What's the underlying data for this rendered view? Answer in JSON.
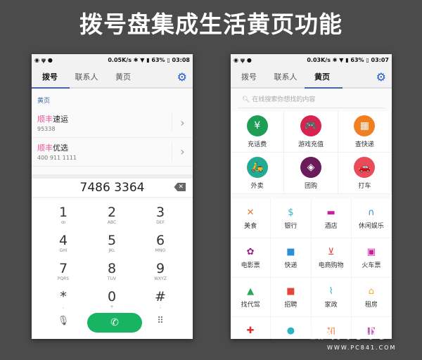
{
  "title": "拨号盘集成生活黄页功能",
  "left": {
    "status": {
      "speed": "0.05K/s",
      "battery": "63%",
      "time": "03:08"
    },
    "tabs": [
      "拨号",
      "联系人",
      "黄页"
    ],
    "section": "黄页",
    "items": [
      {
        "brand": "顺丰",
        "name": "速运",
        "phone": "95338"
      },
      {
        "brand": "顺丰",
        "name": "优选",
        "phone": "400 911 1111"
      }
    ],
    "number": "7486 3364",
    "keys": [
      {
        "d": "1",
        "l": "ꝏ"
      },
      {
        "d": "2",
        "l": "ABC"
      },
      {
        "d": "3",
        "l": "DEF"
      },
      {
        "d": "4",
        "l": "GHI"
      },
      {
        "d": "5",
        "l": "JKL"
      },
      {
        "d": "6",
        "l": "MNO"
      },
      {
        "d": "7",
        "l": "PQRS"
      },
      {
        "d": "8",
        "l": "TUV"
      },
      {
        "d": "9",
        "l": "WXYZ"
      },
      {
        "d": "*",
        "l": ","
      },
      {
        "d": "0",
        "l": "+"
      },
      {
        "d": "#",
        "l": ";"
      }
    ]
  },
  "right": {
    "status": {
      "speed": "0.03K/s",
      "battery": "63%",
      "time": "03:07"
    },
    "tabs": [
      "拨号",
      "联系人",
      "黄页"
    ],
    "search_placeholder": "在线搜索你想找的内容",
    "big": [
      {
        "t": "充话费",
        "c": "#1e9e55",
        "i": "¥"
      },
      {
        "t": "游戏充值",
        "c": "#d9234f",
        "i": "🎮"
      },
      {
        "t": "查快递",
        "c": "#f07f22",
        "i": "▦"
      },
      {
        "t": "外卖",
        "c": "#21ab92",
        "i": "🛵"
      },
      {
        "t": "团购",
        "c": "#6a1c5a",
        "i": "◈"
      },
      {
        "t": "打车",
        "c": "#ea4b5a",
        "i": "🚗"
      }
    ],
    "small": [
      {
        "t": "美食",
        "c": "#e8762a",
        "i": "✕"
      },
      {
        "t": "银行",
        "c": "#2bb3c9",
        "i": "$"
      },
      {
        "t": "酒店",
        "c": "#d21a9f",
        "i": "▬"
      },
      {
        "t": "休闲娱乐",
        "c": "#2b8fd8",
        "i": "∩"
      },
      {
        "t": "电影票",
        "c": "#9a1b8a",
        "i": "✿"
      },
      {
        "t": "快递",
        "c": "#2b8fd8",
        "i": "■"
      },
      {
        "t": "电商购物",
        "c": "#e53a3a",
        "i": "⊻"
      },
      {
        "t": "火车票",
        "c": "#d21a9f",
        "i": "▣"
      },
      {
        "t": "找代驾",
        "c": "#27a857",
        "i": "▲"
      },
      {
        "t": "招聘",
        "c": "#e2473a",
        "i": "■"
      },
      {
        "t": "家政",
        "c": "#2bb3c9",
        "i": "⌇"
      },
      {
        "t": "租房",
        "c": "#eab11a",
        "i": "⌂"
      },
      {
        "t": "",
        "c": "#e02b2b",
        "i": "✚"
      },
      {
        "t": "",
        "c": "#2bb3c9",
        "i": "●"
      },
      {
        "t": "",
        "c": "#e8762a",
        "i": "▦"
      },
      {
        "t": "",
        "c": "#9a1b8a",
        "i": "▦"
      }
    ]
  },
  "watermark": {
    "text": "电脑百事网",
    "url": "WWW.PC841.COM"
  }
}
